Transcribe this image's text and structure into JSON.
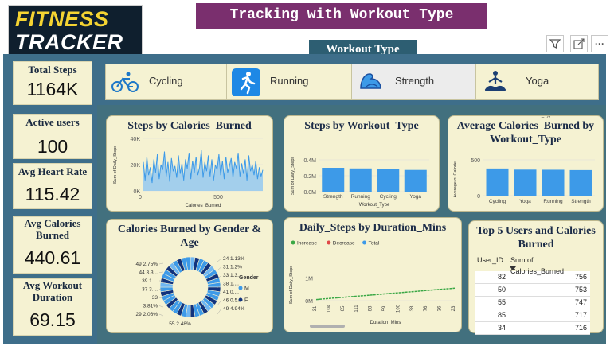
{
  "logo": {
    "line1": "FITNESS",
    "line2": "TRACKER"
  },
  "title": "Tracking with Workout Type",
  "workout_type_label": "Workout Type",
  "toolbar_icons": [
    "filter-icon",
    "expand-icon",
    "more-options-icon"
  ],
  "more_glyph": "···",
  "slicer": [
    {
      "label": "Cycling",
      "icon": "cycling-icon",
      "selected": false
    },
    {
      "label": "Running",
      "icon": "running-icon",
      "selected": false
    },
    {
      "label": "Strength",
      "icon": "strength-icon",
      "selected": true
    },
    {
      "label": "Yoga",
      "icon": "yoga-icon",
      "selected": false
    }
  ],
  "kpis": [
    {
      "label": "Total Steps",
      "value": "1164K"
    },
    {
      "label": "Active users",
      "value": "100"
    },
    {
      "label": "Avg Heart Rate",
      "value": "115.42"
    },
    {
      "label": "Avg Calories Burned",
      "value": "440.61"
    },
    {
      "label": "Avg Workout Duration",
      "value": "69.15"
    }
  ],
  "colors": {
    "bar": "#3d9ae8",
    "donut_m": "#3d9ae8",
    "donut_f": "#12337d",
    "increase": "#3aa845",
    "decrease": "#e04848",
    "total": "#3d9ae8",
    "card_bg": "#f5f2d2",
    "panel": "#3e6e8a"
  },
  "chart_data": [
    {
      "id": "steps_by_calories",
      "type": "area",
      "title": "Steps by Calories_Burned",
      "xlabel": "Calories_Burned",
      "ylabel": "Sum of Daily_Steps",
      "yticks": [
        "40K",
        "20K",
        "0K"
      ],
      "xticks": [
        "0",
        "500"
      ],
      "ylim": [
        0,
        40000
      ],
      "x": [
        120,
        130,
        140,
        150,
        160,
        170,
        180,
        190,
        200,
        210,
        220,
        230,
        240,
        250,
        260,
        270,
        280,
        290,
        300,
        310,
        320,
        330,
        340,
        350,
        360,
        370,
        380,
        390,
        400,
        410,
        420,
        430,
        440,
        450,
        460,
        470,
        480,
        490,
        500,
        510,
        520,
        530,
        540,
        550,
        560,
        570,
        580,
        590,
        600,
        610,
        620,
        630,
        640,
        650,
        660,
        670,
        680,
        690,
        700,
        710,
        720,
        730,
        740,
        750,
        760,
        770,
        780,
        790,
        800
      ],
      "y": [
        22000,
        8000,
        26000,
        12000,
        18000,
        6000,
        24000,
        14000,
        28000,
        9000,
        20000,
        16000,
        30000,
        11000,
        22000,
        7000,
        25000,
        15000,
        19000,
        10000,
        27000,
        13000,
        21000,
        8000,
        24000,
        17000,
        29000,
        9000,
        23000,
        14000,
        26000,
        12000,
        18000,
        31000,
        10000,
        22000,
        15000,
        27000,
        11000,
        24000,
        8000,
        20000,
        16000,
        28000,
        12000,
        23000,
        9000,
        26000,
        14000,
        19000,
        25000,
        10000,
        22000,
        17000,
        29000,
        11000,
        21000,
        13000,
        24000,
        8000,
        27000,
        15000,
        20000,
        12000,
        23000,
        9000,
        18000,
        11000,
        16000
      ]
    },
    {
      "id": "steps_by_workout",
      "type": "bar",
      "title": "Steps by Workout_Type",
      "xlabel": "Workout_Type",
      "ylabel": "Sum of Daily_Steps",
      "yticks": [
        "0.4M",
        "0.2M",
        "0.0M"
      ],
      "ylim": [
        0,
        0.4
      ],
      "categories": [
        "Strength",
        "Running",
        "Cycling",
        "Yoga"
      ],
      "values": [
        0.3,
        0.292,
        0.283,
        0.273
      ]
    },
    {
      "id": "avg_calories_by_workout",
      "type": "bar",
      "title": "Average Calories_Burned by Workout_Type",
      "xlabel": "Workout_Type",
      "ylabel": "Average of Calorie...",
      "yticks": [
        "500",
        "0"
      ],
      "ylim": [
        0,
        600
      ],
      "categories": [
        "Cycling",
        "Yoga",
        "Running",
        "Strength"
      ],
      "values": [
        455,
        436,
        434,
        428
      ]
    },
    {
      "id": "calories_by_gender_age",
      "type": "pie",
      "title": "Calories Burned by Gender & Age",
      "legend_title": "Gender",
      "legend": [
        "M",
        "F"
      ],
      "labels_left": [
        "49 2.75%",
        "44 3.3...",
        "39 1....",
        "37 3....",
        "33",
        "3.81%",
        "29 2.06%"
      ],
      "labels_right": [
        "24 1.13%",
        "31 1.2%",
        "33 1.3...",
        "38 1....",
        "41 0....",
        "46 0.5...",
        "49 4.94%"
      ],
      "label_bottom": "55 2.48%"
    },
    {
      "id": "daily_steps_by_duration",
      "type": "line",
      "title": "Daily_Steps by Duration_Mins",
      "legend": [
        "Increase",
        "Decrease",
        "Total"
      ],
      "xlabel": "Duration_Mins",
      "ylabel": "Sum of Daily_Steps",
      "yticks": [
        "1M",
        "0M"
      ],
      "ylim": [
        0,
        1.4
      ],
      "xticks": [
        "31",
        "104",
        "65",
        "111",
        "88",
        "59",
        "100",
        "38",
        "76",
        "36",
        "23"
      ],
      "x": [
        0,
        1,
        2,
        3,
        4,
        5,
        6,
        7,
        8,
        9,
        10
      ],
      "values": [
        0.05,
        0.1,
        0.15,
        0.2,
        0.25,
        0.3,
        0.35,
        0.4,
        0.45,
        0.5,
        0.55
      ]
    },
    {
      "id": "top5_users",
      "type": "table",
      "title": "Top 5 Users and Calories Burned",
      "columns": [
        "User_ID",
        "Sum of Calories_Burned"
      ],
      "rows": [
        [
          "82",
          "756"
        ],
        [
          "50",
          "753"
        ],
        [
          "55",
          "747"
        ],
        [
          "85",
          "717"
        ],
        [
          "34",
          "716"
        ]
      ]
    }
  ]
}
